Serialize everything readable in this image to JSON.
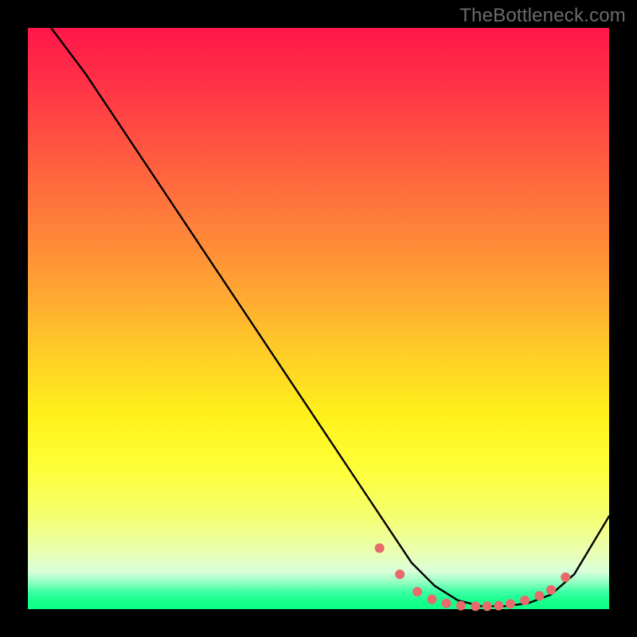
{
  "brand": "TheBottleneck.com",
  "chart_data": {
    "type": "line",
    "title": "",
    "xlabel": "",
    "ylabel": "",
    "xlim": [
      0,
      100
    ],
    "ylim": [
      0,
      100
    ],
    "grid": false,
    "series": [
      {
        "name": "curve",
        "color": "#000000",
        "x": [
          4,
          10,
          20,
          30,
          40,
          50,
          58,
          62,
          66,
          70,
          74,
          78,
          82,
          86,
          90,
          94,
          100
        ],
        "y": [
          100,
          92,
          77,
          62,
          47,
          32,
          20,
          14,
          8,
          4,
          1.5,
          0.5,
          0.5,
          1,
          2.5,
          6,
          16
        ]
      }
    ],
    "markers": {
      "name": "dots",
      "color": "#e86a6a",
      "radius": 6,
      "x": [
        60.5,
        64,
        67,
        69.5,
        72,
        74.5,
        77,
        79,
        81,
        83,
        85.5,
        88,
        90,
        92.5
      ],
      "y": [
        10.5,
        6,
        3,
        1.7,
        1,
        0.6,
        0.5,
        0.5,
        0.6,
        0.9,
        1.5,
        2.3,
        3.3,
        5.5
      ]
    }
  }
}
